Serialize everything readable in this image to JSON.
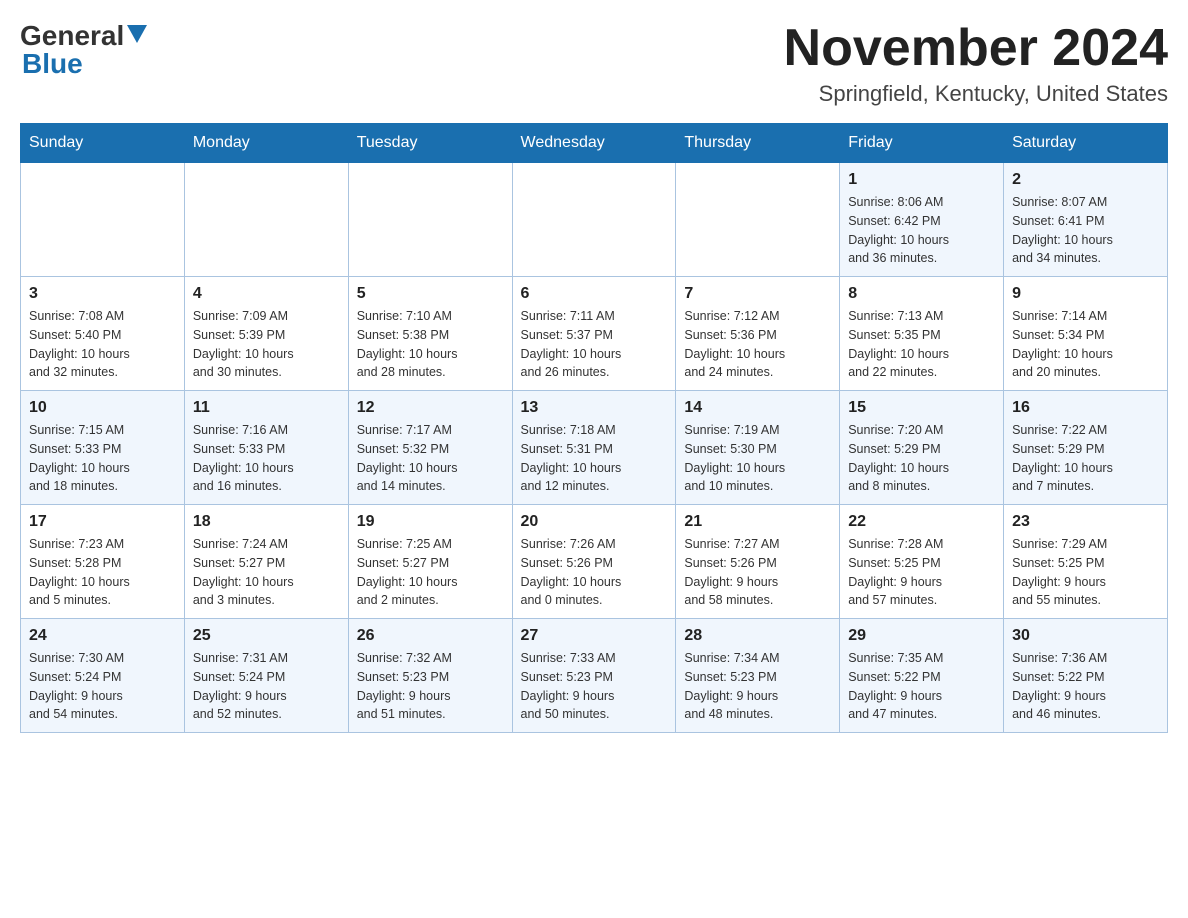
{
  "logo": {
    "general": "General",
    "blue": "Blue"
  },
  "title": "November 2024",
  "location": "Springfield, Kentucky, United States",
  "days_of_week": [
    "Sunday",
    "Monday",
    "Tuesday",
    "Wednesday",
    "Thursday",
    "Friday",
    "Saturday"
  ],
  "weeks": [
    {
      "row_class": "row-first",
      "days": [
        {
          "number": "",
          "info": ""
        },
        {
          "number": "",
          "info": ""
        },
        {
          "number": "",
          "info": ""
        },
        {
          "number": "",
          "info": ""
        },
        {
          "number": "",
          "info": ""
        },
        {
          "number": "1",
          "info": "Sunrise: 8:06 AM\nSunset: 6:42 PM\nDaylight: 10 hours\nand 36 minutes."
        },
        {
          "number": "2",
          "info": "Sunrise: 8:07 AM\nSunset: 6:41 PM\nDaylight: 10 hours\nand 34 minutes."
        }
      ]
    },
    {
      "row_class": "row-odd",
      "days": [
        {
          "number": "3",
          "info": "Sunrise: 7:08 AM\nSunset: 5:40 PM\nDaylight: 10 hours\nand 32 minutes."
        },
        {
          "number": "4",
          "info": "Sunrise: 7:09 AM\nSunset: 5:39 PM\nDaylight: 10 hours\nand 30 minutes."
        },
        {
          "number": "5",
          "info": "Sunrise: 7:10 AM\nSunset: 5:38 PM\nDaylight: 10 hours\nand 28 minutes."
        },
        {
          "number": "6",
          "info": "Sunrise: 7:11 AM\nSunset: 5:37 PM\nDaylight: 10 hours\nand 26 minutes."
        },
        {
          "number": "7",
          "info": "Sunrise: 7:12 AM\nSunset: 5:36 PM\nDaylight: 10 hours\nand 24 minutes."
        },
        {
          "number": "8",
          "info": "Sunrise: 7:13 AM\nSunset: 5:35 PM\nDaylight: 10 hours\nand 22 minutes."
        },
        {
          "number": "9",
          "info": "Sunrise: 7:14 AM\nSunset: 5:34 PM\nDaylight: 10 hours\nand 20 minutes."
        }
      ]
    },
    {
      "row_class": "row-even",
      "days": [
        {
          "number": "10",
          "info": "Sunrise: 7:15 AM\nSunset: 5:33 PM\nDaylight: 10 hours\nand 18 minutes."
        },
        {
          "number": "11",
          "info": "Sunrise: 7:16 AM\nSunset: 5:33 PM\nDaylight: 10 hours\nand 16 minutes."
        },
        {
          "number": "12",
          "info": "Sunrise: 7:17 AM\nSunset: 5:32 PM\nDaylight: 10 hours\nand 14 minutes."
        },
        {
          "number": "13",
          "info": "Sunrise: 7:18 AM\nSunset: 5:31 PM\nDaylight: 10 hours\nand 12 minutes."
        },
        {
          "number": "14",
          "info": "Sunrise: 7:19 AM\nSunset: 5:30 PM\nDaylight: 10 hours\nand 10 minutes."
        },
        {
          "number": "15",
          "info": "Sunrise: 7:20 AM\nSunset: 5:29 PM\nDaylight: 10 hours\nand 8 minutes."
        },
        {
          "number": "16",
          "info": "Sunrise: 7:22 AM\nSunset: 5:29 PM\nDaylight: 10 hours\nand 7 minutes."
        }
      ]
    },
    {
      "row_class": "row-odd",
      "days": [
        {
          "number": "17",
          "info": "Sunrise: 7:23 AM\nSunset: 5:28 PM\nDaylight: 10 hours\nand 5 minutes."
        },
        {
          "number": "18",
          "info": "Sunrise: 7:24 AM\nSunset: 5:27 PM\nDaylight: 10 hours\nand 3 minutes."
        },
        {
          "number": "19",
          "info": "Sunrise: 7:25 AM\nSunset: 5:27 PM\nDaylight: 10 hours\nand 2 minutes."
        },
        {
          "number": "20",
          "info": "Sunrise: 7:26 AM\nSunset: 5:26 PM\nDaylight: 10 hours\nand 0 minutes."
        },
        {
          "number": "21",
          "info": "Sunrise: 7:27 AM\nSunset: 5:26 PM\nDaylight: 9 hours\nand 58 minutes."
        },
        {
          "number": "22",
          "info": "Sunrise: 7:28 AM\nSunset: 5:25 PM\nDaylight: 9 hours\nand 57 minutes."
        },
        {
          "number": "23",
          "info": "Sunrise: 7:29 AM\nSunset: 5:25 PM\nDaylight: 9 hours\nand 55 minutes."
        }
      ]
    },
    {
      "row_class": "row-even",
      "days": [
        {
          "number": "24",
          "info": "Sunrise: 7:30 AM\nSunset: 5:24 PM\nDaylight: 9 hours\nand 54 minutes."
        },
        {
          "number": "25",
          "info": "Sunrise: 7:31 AM\nSunset: 5:24 PM\nDaylight: 9 hours\nand 52 minutes."
        },
        {
          "number": "26",
          "info": "Sunrise: 7:32 AM\nSunset: 5:23 PM\nDaylight: 9 hours\nand 51 minutes."
        },
        {
          "number": "27",
          "info": "Sunrise: 7:33 AM\nSunset: 5:23 PM\nDaylight: 9 hours\nand 50 minutes."
        },
        {
          "number": "28",
          "info": "Sunrise: 7:34 AM\nSunset: 5:23 PM\nDaylight: 9 hours\nand 48 minutes."
        },
        {
          "number": "29",
          "info": "Sunrise: 7:35 AM\nSunset: 5:22 PM\nDaylight: 9 hours\nand 47 minutes."
        },
        {
          "number": "30",
          "info": "Sunrise: 7:36 AM\nSunset: 5:22 PM\nDaylight: 9 hours\nand 46 minutes."
        }
      ]
    }
  ]
}
